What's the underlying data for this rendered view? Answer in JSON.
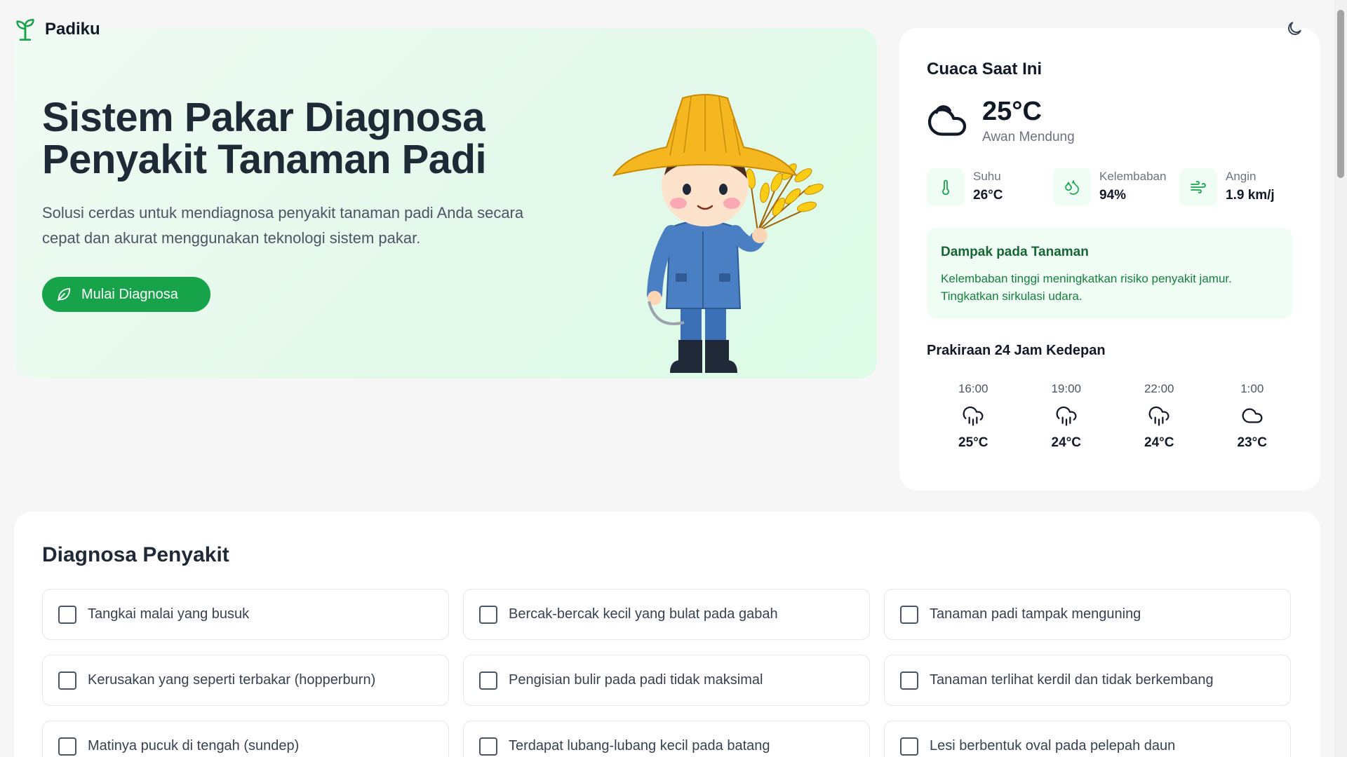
{
  "app": {
    "name": "Padiku"
  },
  "hero": {
    "title": "Sistem Pakar Diagnosa Penyakit Tanaman Padi",
    "subtitle": "Solusi cerdas untuk mendiagnosa penyakit tanaman padi Anda secara cepat dan akurat menggunakan teknologi sistem pakar.",
    "cta_label": "Mulai Diagnosa"
  },
  "weather": {
    "title": "Cuaca Saat Ini",
    "temperature": "25°C",
    "condition": "Awan Mendung",
    "condition_icon": "cloud-icon",
    "stats": [
      {
        "label": "Suhu",
        "value": "26°C",
        "icon": "thermometer-icon"
      },
      {
        "label": "Kelembaban",
        "value": "94%",
        "icon": "droplets-icon"
      },
      {
        "label": "Angin",
        "value": "1.9 km/j",
        "icon": "wind-icon"
      }
    ],
    "impact": {
      "title": "Dampak pada Tanaman",
      "text": "Kelembaban tinggi meningkatkan risiko penyakit jamur. Tingkatkan sirkulasi udara."
    },
    "forecast_title": "Prakiraan 24 Jam Kedepan",
    "forecast": [
      {
        "time": "16:00",
        "temp": "25°C",
        "icon": "cloud-rain-icon"
      },
      {
        "time": "19:00",
        "temp": "24°C",
        "icon": "cloud-rain-icon"
      },
      {
        "time": "22:00",
        "temp": "24°C",
        "icon": "cloud-rain-icon"
      },
      {
        "time": "1:00",
        "temp": "23°C",
        "icon": "cloud-icon"
      }
    ]
  },
  "diagnosis": {
    "title": "Diagnosa Penyakit",
    "symptoms": [
      "Tangkai malai yang busuk",
      "Bercak-bercak kecil yang bulat pada gabah",
      "Tanaman padi tampak menguning",
      "Kerusakan yang seperti terbakar (hopperburn)",
      "Pengisian bulir pada padi tidak maksimal",
      "Tanaman terlihat kerdil dan tidak berkembang",
      "Matinya pucuk di tengah (sundep)",
      "Terdapat lubang-lubang kecil pada batang",
      "Lesi berbentuk oval pada pelepah daun"
    ]
  },
  "colors": {
    "accent": "#16a34a",
    "hero_bg": "#e3f8ea",
    "impact_bg": "#f0fdf4"
  }
}
